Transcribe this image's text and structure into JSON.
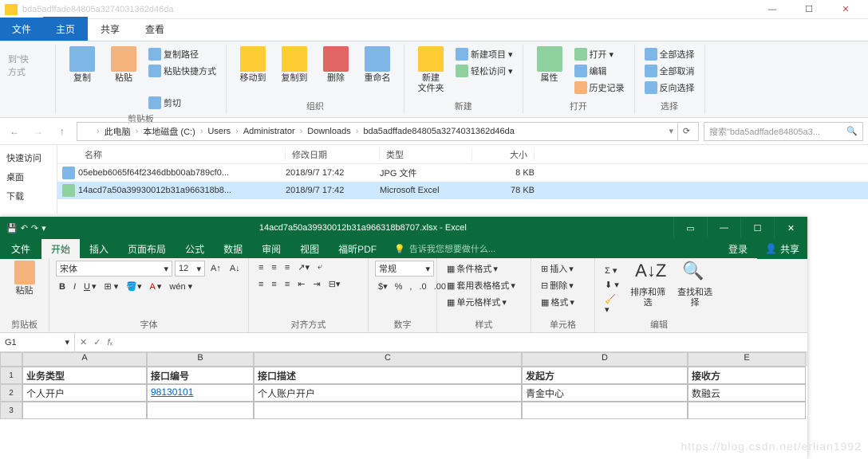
{
  "explorer": {
    "title_path": "bda5adffade84805a3274031362d46da",
    "tabs": {
      "home": "主页",
      "share": "共享",
      "view": "查看"
    },
    "ribbon": {
      "clipboard": {
        "copy": "复制",
        "paste": "粘贴",
        "copy_path": "复制路径",
        "paste_shortcut": "粘贴快捷方式",
        "cut": "剪切",
        "label": "剪贴板"
      },
      "organize": {
        "move_to": "移动到",
        "copy_to": "复制到",
        "delete": "删除",
        "rename": "重命名",
        "label": "组织"
      },
      "new": {
        "new_folder": "新建\n文件夹",
        "new_item": "新建项目",
        "easy_access": "轻松访问",
        "label": "新建"
      },
      "open": {
        "properties": "属性",
        "open": "打开",
        "edit": "编辑",
        "history": "历史记录",
        "label": "打开"
      },
      "select": {
        "select_all": "全部选择",
        "select_none": "全部取消",
        "invert": "反向选择",
        "label": "选择"
      }
    },
    "sidebar": {
      "quick_header": "快速访问",
      "desktop": "桌面",
      "downloads": "下载"
    },
    "breadcrumb": [
      "此电脑",
      "本地磁盘 (C:)",
      "Users",
      "Administrator",
      "Downloads",
      "bda5adffade84805a3274031362d46da"
    ],
    "search_placeholder": "搜索\"bda5adffade84805a3...",
    "columns": {
      "name": "名称",
      "date": "修改日期",
      "type": "类型",
      "size": "大小"
    },
    "files": [
      {
        "name": "05ebeb6065f64f2346dbb00ab789cf0...",
        "date": "2018/9/7 17:42",
        "type": "JPG 文件",
        "size": "8 KB"
      },
      {
        "name": "14acd7a50a39930012b31a966318b8...",
        "date": "2018/9/7 17:42",
        "type": "Microsoft Excel",
        "size": "78 KB"
      }
    ]
  },
  "excel": {
    "title": "14acd7a50a39930012b31a966318b8707.xlsx - Excel",
    "tabs": {
      "file": "文件",
      "home": "开始",
      "insert": "插入",
      "layout": "页面布局",
      "formula": "公式",
      "data": "数据",
      "review": "审阅",
      "view": "视图",
      "foxit": "福昕PDF"
    },
    "tell_me": "告诉我您想要做什么...",
    "login": "登录",
    "share": "共享",
    "ribbon": {
      "clipboard": {
        "paste": "粘贴",
        "label": "剪贴板"
      },
      "font": {
        "name": "宋体",
        "size": "12",
        "label": "字体"
      },
      "align": {
        "label": "对齐方式"
      },
      "number": {
        "general": "常规",
        "label": "数字"
      },
      "styles": {
        "cond": "条件格式",
        "table": "套用表格格式",
        "cell": "单元格样式",
        "label": "样式"
      },
      "cells": {
        "insert": "插入",
        "delete": "删除",
        "format": "格式",
        "label": "单元格"
      },
      "editing": {
        "sort": "排序和筛选",
        "find": "查找和选择",
        "label": "编辑"
      }
    },
    "namebox": "G1",
    "columns": [
      "A",
      "B",
      "C",
      "D",
      "E"
    ],
    "rows": [
      {
        "n": "1",
        "A": "业务类型",
        "B": "接口编号",
        "C": "接口描述",
        "D": "发起方",
        "E": "接收方",
        "header": true
      },
      {
        "n": "2",
        "A": "个人开户",
        "B": "98130101",
        "C": "个人账户开户",
        "D": "青金中心",
        "E": "数融云"
      },
      {
        "n": "3",
        "A": "",
        "B": "",
        "C": "",
        "D": "",
        "E": ""
      }
    ]
  },
  "watermark": "https://blog.csdn.net/erlian1992"
}
